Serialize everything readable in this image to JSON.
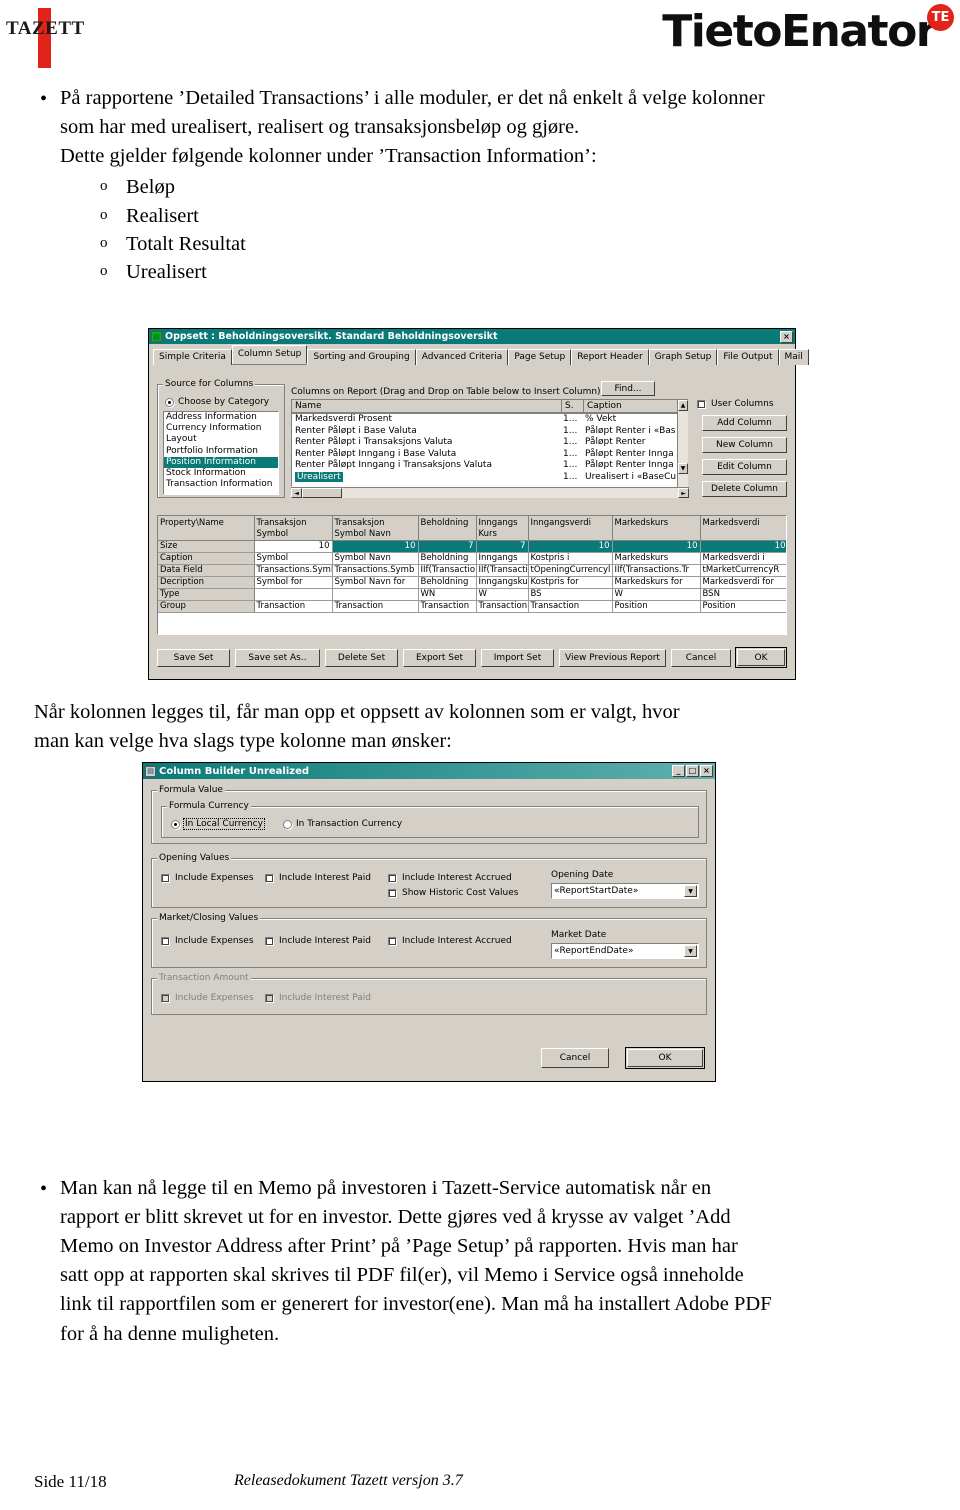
{
  "header": {
    "tazett_logo": "TAZETT",
    "tietoenator_logo": "TietoEnator",
    "te_mark": "TE"
  },
  "intro": {
    "bullet_lines": [
      "På rapportene ’Detailed Transactions’ i alle moduler, er det nå enkelt å velge kolonner",
      "som har med urealisert, realisert og transaksjonsbeløp og gjøre.",
      "Dette gjelder følgende kolonner under ’Transaction Information’:"
    ],
    "sub_items": [
      "Beløp",
      "Realisert",
      "Totalt Resultat",
      "Urealisert"
    ]
  },
  "middle_text": [
    "Når kolonnen legges til, får man opp et oppsett av kolonnen som er valgt, hvor",
    "man kan velge hva slags type kolonne man ønsker:"
  ],
  "dialog1": {
    "title": "Oppsett : Beholdningsoversikt. Standard Beholdningsoversikt",
    "close_label": "×",
    "tabs": [
      {
        "label": "Simple Criteria",
        "active": false
      },
      {
        "label": "Column Setup",
        "active": true
      },
      {
        "label": "Sorting and Grouping",
        "active": false
      },
      {
        "label": "Advanced Criteria",
        "active": false
      },
      {
        "label": "Page Setup",
        "active": false
      },
      {
        "label": "Report Header",
        "active": false
      },
      {
        "label": "Graph Setup",
        "active": false
      },
      {
        "label": "File Output",
        "active": false
      },
      {
        "label": "Mail",
        "active": false
      }
    ],
    "source_group_label": "Source for Columns",
    "choose_by_category_label": "Choose by Category",
    "categories": [
      "Address Information",
      "Currency Information",
      "Layout",
      "Portfolio Information",
      "Position Information",
      "Stock Information",
      "Transaction Information"
    ],
    "selected_category": "Position Information",
    "columns_on_report_label": "Columns on Report (Drag and Drop on Table below to Insert Column) :",
    "find_button": "Find...",
    "col_header_name": "Name",
    "col_header_s": "S.",
    "col_header_caption": "Caption",
    "report_columns": [
      {
        "name": "Markedsverdi Prosent",
        "s": "1...",
        "caption": "% Vekt"
      },
      {
        "name": "Renter Påløpt i Base Valuta",
        "s": "1...",
        "caption": "Påløpt Renter i «Bas"
      },
      {
        "name": "Renter Påløpt i Transaksjons Valuta",
        "s": "1...",
        "caption": "Påløpt Renter"
      },
      {
        "name": "Renter Påløpt Inngang i Base Valuta",
        "s": "1...",
        "caption": "Påløpt Renter Innga"
      },
      {
        "name": "Renter Påløpt Inngang i Transaksjons Valuta",
        "s": "1...",
        "caption": "Påløpt Renter Innga"
      },
      {
        "name": "Urealisert",
        "s": "1...",
        "caption": "Urealisert i «BaseCu"
      }
    ],
    "selected_report_column": "Urealisert",
    "user_columns_label": "User Columns",
    "side_buttons": [
      "Add Column",
      "New Column",
      "Edit Column",
      "Delete Column"
    ],
    "grid": {
      "row_headers": [
        "Property\\Name",
        "Size",
        "Caption",
        "Data Field",
        "Decription",
        "Type",
        "Group"
      ],
      "columns": [
        {
          "header": "Transaksjon\nSymbol",
          "size": "10",
          "caption": "Symbol",
          "data_field": "Transactions.Symb",
          "description": "Symbol for",
          "type": "",
          "group": "Transaction"
        },
        {
          "header": "Transaksjon\nSymbol Navn",
          "size": "10",
          "caption": "Symbol Navn",
          "data_field": "Transactions.Symb",
          "description": "Symbol Navn for",
          "type": "",
          "group": "Transaction"
        },
        {
          "header": "Beholdning",
          "size": "7",
          "caption": "Beholdning",
          "data_field": "IIf(Transactio",
          "description": "Beholdning",
          "type": "WN",
          "group": "Transaction"
        },
        {
          "header": "Inngangs\nKurs",
          "size": "7",
          "caption": "Inngangs",
          "data_field": "IIf(Transactio",
          "description": "Inngangskur",
          "type": "W",
          "group": "Transaction"
        },
        {
          "header": "Inngangsverdi",
          "size": "10",
          "caption": "Kostpris i",
          "data_field": "tOpeningCurrencyl",
          "description": "Kostpris for",
          "type": "BS",
          "group": "Transaction"
        },
        {
          "header": "Markedskurs",
          "size": "10",
          "caption": "Markedskurs",
          "data_field": "IIf(Transactions.Tr",
          "description": "Markedskurs for",
          "type": "W",
          "group": "Position"
        },
        {
          "header": "Markedsverdi",
          "size": "10",
          "caption": "Markedsverdi i",
          "data_field": "tMarketCurrencyR",
          "description": "Markedsverdi for",
          "type": "BSN",
          "group": "Position"
        }
      ]
    },
    "bottom_buttons": [
      "Save Set",
      "Save set As..",
      "Delete Set",
      "Export Set",
      "Import Set",
      "View Previous Report",
      "Cancel",
      "OK"
    ],
    "default_button": "OK"
  },
  "dialog2": {
    "title": "Column Builder Unrealized",
    "window_buttons": [
      "_",
      "□",
      "×"
    ],
    "formula_value_label": "Formula Value",
    "formula_currency_label": "Formula Currency",
    "radios": [
      {
        "label": "In Local Currency",
        "checked": true
      },
      {
        "label": "In Transaction Currency",
        "checked": false
      }
    ],
    "opening_values": {
      "label": "Opening Values",
      "checks": [
        "Include Expenses",
        "Include Interest Paid",
        "Include Interest Accrued",
        "Show Historic Cost Values"
      ],
      "date_label": "Opening Date",
      "date_value": "«ReportStartDate»"
    },
    "market_values": {
      "label": "Market/Closing Values",
      "checks": [
        "Include Expenses",
        "Include Interest Paid",
        "Include Interest Accrued"
      ],
      "date_label": "Market Date",
      "date_value": "«ReportEndDate»"
    },
    "transaction_amount": {
      "label": "Transaction Amount",
      "checks": [
        "Include Expenses",
        "Include Interest Paid"
      ],
      "disabled": true
    },
    "cancel_label": "Cancel",
    "ok_label": "OK"
  },
  "outro": {
    "bullet_lines": [
      "Man kan nå legge til en Memo på investoren i Tazett-Service automatisk når en",
      "rapport er blitt skrevet ut for en investor. Dette gjøres ved å krysse av valget ’Add",
      "Memo on Investor Address after Print’ på ’Page Setup’ på rapporten. Hvis man har",
      "satt opp at rapporten skal skrives til PDF fil(er), vil Memo i Service også inneholde",
      "link til rapportfilen som er generert for investor(ene). Man må ha installert Adobe PDF",
      "for å ha denne muligheten."
    ]
  },
  "footer": {
    "page": "Side 11/18",
    "center": "Releasedokument Tazett versjon 3.7"
  }
}
